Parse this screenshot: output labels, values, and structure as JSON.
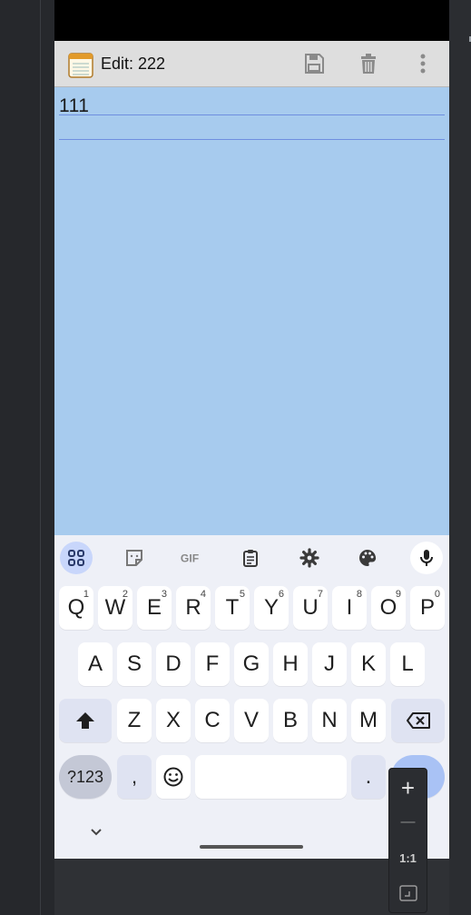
{
  "action_bar": {
    "title": "Edit: 222",
    "icons": {
      "app": "notepad-icon",
      "save": "save-icon",
      "delete": "trash-icon",
      "menu": "overflow-menu-icon"
    }
  },
  "editor": {
    "text": "111"
  },
  "keyboard": {
    "toolbar": [
      "apps-grid-icon",
      "sticker-icon",
      "gif-icon",
      "clipboard-icon",
      "settings-icon",
      "palette-icon",
      "mic-icon"
    ],
    "row1": [
      {
        "label": "Q",
        "hint": "1"
      },
      {
        "label": "W",
        "hint": "2"
      },
      {
        "label": "E",
        "hint": "3"
      },
      {
        "label": "R",
        "hint": "4"
      },
      {
        "label": "T",
        "hint": "5"
      },
      {
        "label": "Y",
        "hint": "6"
      },
      {
        "label": "U",
        "hint": "7"
      },
      {
        "label": "I",
        "hint": "8"
      },
      {
        "label": "O",
        "hint": "9"
      },
      {
        "label": "P",
        "hint": "0"
      }
    ],
    "row2": [
      "A",
      "S",
      "D",
      "F",
      "G",
      "H",
      "J",
      "K",
      "L"
    ],
    "row3": [
      "Z",
      "X",
      "C",
      "V",
      "B",
      "N",
      "M"
    ],
    "symbols_label": "?123",
    "comma_label": ",",
    "period_label": ".",
    "space_label": ""
  },
  "zoom": {
    "zoom_in": "+",
    "zoom_out": "—",
    "actual_size": "1:1"
  },
  "colors": {
    "editor_bg": "#a7cbee",
    "ruled_line": "#6f8fe0",
    "action_bar": "#dedede",
    "keyboard_bg": "#eef0f7"
  }
}
